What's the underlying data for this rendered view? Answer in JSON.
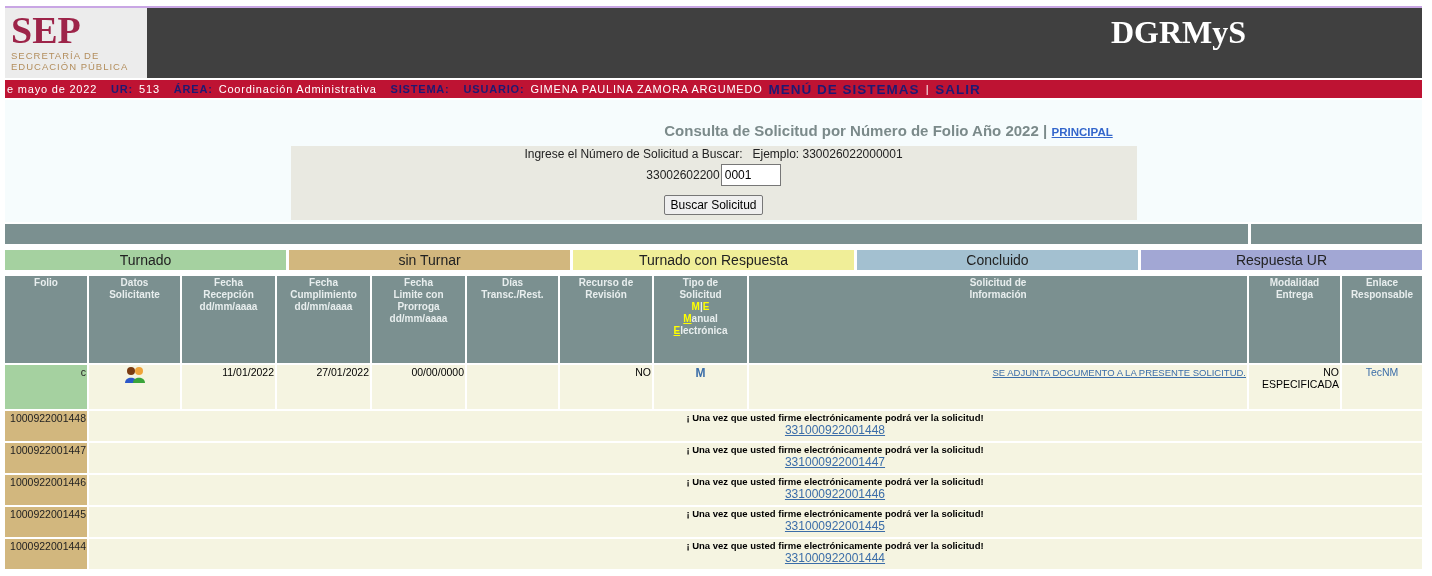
{
  "header": {
    "logo": {
      "mark": "SEP",
      "line1": "SECRETARÍA DE",
      "line2": "EDUCACIÓN PÚBLICA"
    },
    "title": "DGRMyS"
  },
  "info_bar": {
    "date": "e mayo de 2022",
    "fields": [
      {
        "label": "UR:",
        "value": "513"
      },
      {
        "label": "ÁREA:",
        "value": "Coordinación Administrativa"
      },
      {
        "label": "SISTEMA:"
      },
      {
        "label": "USUARIO:",
        "value": "GIMENA PAULINA ZAMORA ARGUMEDO"
      }
    ],
    "links": [
      "MENÚ DE SISTEMAS",
      "SALIR"
    ],
    "separator": "|"
  },
  "search": {
    "title": "Consulta de Solicitud por Número de Folio Año 2022",
    "separator": "|",
    "home_link": "PRINCIPAL",
    "instruction": "Ingrese el Número de Solicitud a Buscar:",
    "example": "Ejemplo: 330026022000001",
    "prefix": "33002602200",
    "value": "0001",
    "button": "Buscar Solicitud"
  },
  "legend": [
    {
      "label": "Turnado",
      "color": "#a5d1a0"
    },
    {
      "label": "sin Turnar",
      "color": "#d2b77e"
    },
    {
      "label": "Turnado con Respuesta",
      "color": "#f0ee98"
    },
    {
      "label": "Concluido",
      "color": "#a3c0d0"
    },
    {
      "label": "Respuesta UR",
      "color": "#a2a7d4"
    }
  ],
  "table": {
    "columns": [
      {
        "lines": [
          "Folio"
        ]
      },
      {
        "lines": [
          "Datos",
          "Solicitante"
        ]
      },
      {
        "lines": [
          "Fecha",
          "Recepción",
          "dd/mm/aaaa"
        ]
      },
      {
        "lines": [
          "Fecha",
          "Cumplimiento",
          "dd/mm/aaaa"
        ]
      },
      {
        "lines": [
          "Fecha",
          "Limite con",
          "Prorroga",
          "dd/mm/aaaa"
        ]
      },
      {
        "lines": [
          "Días",
          "Transc./Rest."
        ]
      },
      {
        "lines": [
          "Recurso de",
          "Revisión"
        ]
      },
      {
        "lines": [
          "Tipo de",
          "Solicitud"
        ],
        "codes": [
          "M",
          "E"
        ],
        "code_separator": "|",
        "meanings": [
          {
            "initial": "M",
            "rest": "anual"
          },
          {
            "initial": "E",
            "rest": "lectrónica"
          }
        ]
      },
      {
        "lines": [
          "Solicitud de",
          "Información"
        ]
      },
      {
        "lines": [
          "Modalidad",
          "Entrega"
        ]
      },
      {
        "lines": [
          "Enlace",
          "Responsable"
        ]
      }
    ],
    "rows": [
      {
        "kind": "detail",
        "folio": "c",
        "color": "#a5d1a0",
        "fecha_recepcion": "11/01/2022",
        "fecha_cumplimiento": "27/01/2022",
        "fecha_limite": "00/00/0000",
        "recurso": "NO",
        "tipo": "M",
        "solicitud": "SE ADJUNTA DOCUMENTO A LA PRESENTE SOLICITUD.",
        "modalidad": "NO ESPECIFICADA",
        "enlace": "TecNM"
      },
      {
        "kind": "locked",
        "folio": "1000922001448",
        "color": "#d2b77e",
        "message": "¡ Una vez que usted firme electrónicamente podrá ver la solicitud!",
        "link": "331000922001448"
      },
      {
        "kind": "locked",
        "folio": "1000922001447",
        "color": "#d2b77e",
        "message": "¡ Una vez que usted firme electrónicamente podrá ver la solicitud!",
        "link": "331000922001447"
      },
      {
        "kind": "locked",
        "folio": "1000922001446",
        "color": "#d2b77e",
        "message": "¡ Una vez que usted firme electrónicamente podrá ver la solicitud!",
        "link": "331000922001446"
      },
      {
        "kind": "locked",
        "folio": "1000922001445",
        "color": "#d2b77e",
        "message": "¡ Una vez que usted firme electrónicamente podrá ver la solicitud!",
        "link": "331000922001445"
      },
      {
        "kind": "locked",
        "folio": "1000922001444",
        "color": "#d2b77e",
        "message": "¡ Una vez que usted firme electrónicamente podrá ver la solicitud!",
        "link": "331000922001444"
      }
    ]
  }
}
